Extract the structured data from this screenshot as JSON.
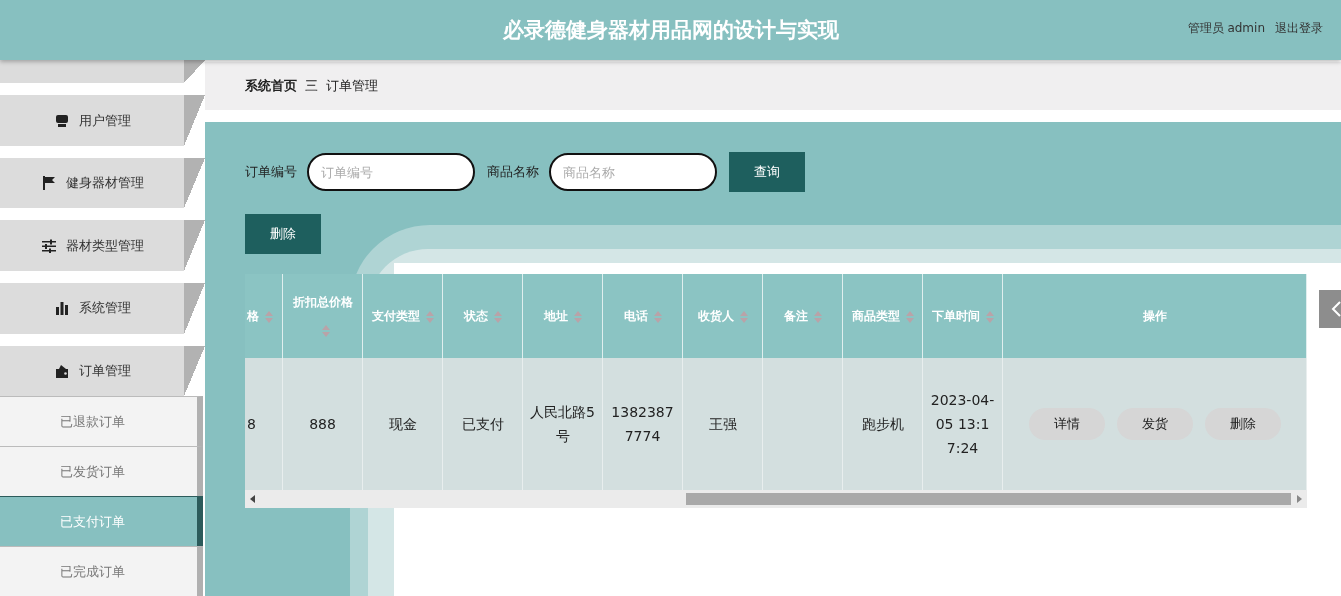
{
  "header": {
    "title": "必录德健身器材用品网的设计与实现",
    "user": "管理员 admin",
    "logout": "退出登录"
  },
  "sidebar": {
    "items": [
      {
        "expanded": false
      },
      {
        "label": "用户管理",
        "expanded": false
      },
      {
        "label": "健身器材管理",
        "expanded": false
      },
      {
        "label": "器材类型管理",
        "expanded": false
      },
      {
        "label": "系统管理",
        "expanded": false
      },
      {
        "label": "订单管理",
        "expanded": true,
        "children": [
          {
            "label": "已退款订单",
            "selected": false
          },
          {
            "label": "已发货订单",
            "selected": false
          },
          {
            "label": "已支付订单",
            "selected": true
          },
          {
            "label": "已完成订单",
            "selected": false
          }
        ]
      }
    ]
  },
  "breadcrumb": [
    "系统首页",
    "三",
    "订单管理"
  ],
  "search": {
    "fields": [
      {
        "label": "订单编号",
        "placeholder": "订单编号"
      },
      {
        "label": "商品名称",
        "placeholder": "商品名称"
      }
    ],
    "button": "查询"
  },
  "delete_button": "删除",
  "table": {
    "columns": [
      {
        "label": "格",
        "sortable": true
      },
      {
        "label": "折扣总价格",
        "sortable": true
      },
      {
        "label": "支付类型",
        "sortable": true
      },
      {
        "label": "状态",
        "sortable": true
      },
      {
        "label": "地址",
        "sortable": true
      },
      {
        "label": "电话",
        "sortable": true
      },
      {
        "label": "收货人",
        "sortable": true
      },
      {
        "label": "备注",
        "sortable": true
      },
      {
        "label": "商品类型",
        "sortable": true
      },
      {
        "label": "下单时间",
        "sortable": true
      },
      {
        "label": "操作",
        "sortable": false
      }
    ],
    "rows": [
      {
        "cells": [
          "8",
          "888",
          "现金",
          "已支付",
          "人民北路5号",
          "13823877774",
          "王强",
          "",
          "跑步机",
          "2023-04-05 13:17:24"
        ],
        "actions": [
          "详情",
          "发货",
          "删除"
        ]
      }
    ]
  }
}
